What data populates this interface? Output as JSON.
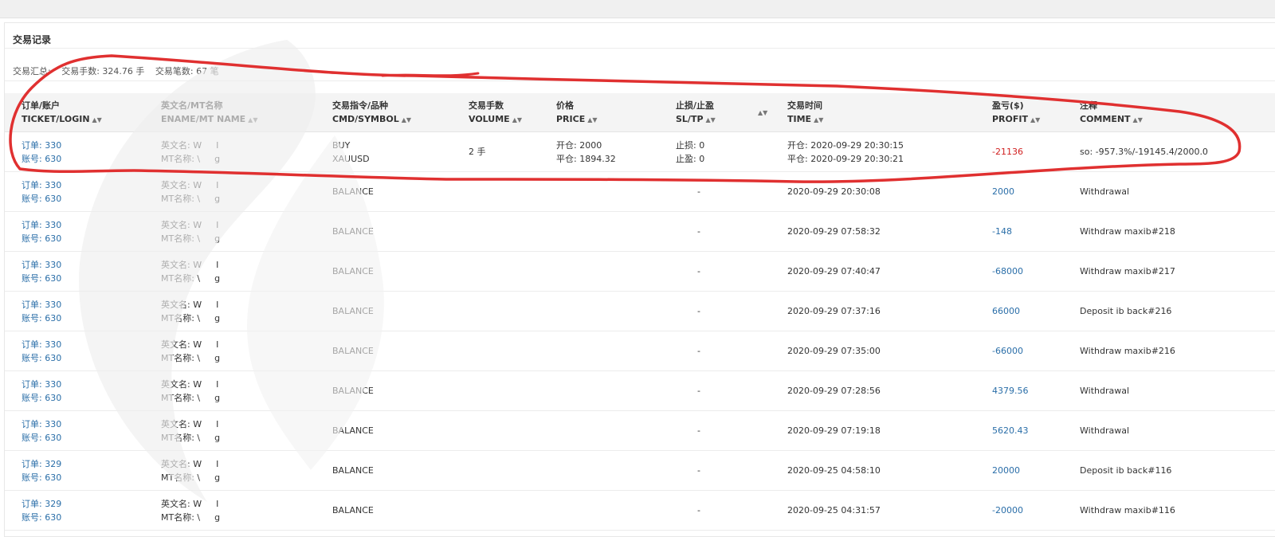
{
  "panel": {
    "title": "交易记录",
    "summary_label": "交易汇总:",
    "volume_summary": "交易手数: 324.76 手",
    "count_summary": "交易笔数: 67 笔"
  },
  "columns": [
    {
      "cn": "订单/账户",
      "en": "TICKET/LOGIN"
    },
    {
      "cn": "英文名/MT名称",
      "en": "ENAME/MT NAME"
    },
    {
      "cn": "交易指令/品种",
      "en": "CMD/SYMBOL"
    },
    {
      "cn": "交易手数",
      "en": "VOLUME"
    },
    {
      "cn": "价格",
      "en": "PRICE"
    },
    {
      "cn": "止损/止盈",
      "en": "SL/TP"
    },
    {
      "cn": "",
      "en": ""
    },
    {
      "cn": "交易时间",
      "en": "TIME"
    },
    {
      "cn": "盈亏($)",
      "en": "PROFIT"
    },
    {
      "cn": "注释",
      "en": "COMMENT"
    }
  ],
  "first_row": {
    "ticket": "订单: 330",
    "login": "账号: 630",
    "ename": "英文名: W",
    "mtname": "MT名称: \\",
    "ename_tail": "I",
    "mtname_tail": "g",
    "cmd": "BUY",
    "symbol": "XAUUSD",
    "volume": "2 手",
    "open_price": "开仓: 2000",
    "close_price": "平仓: 1894.32",
    "sl": "止损: 0",
    "tp": "止盈: 0",
    "open_time": "开仓: 2020-09-29 20:30:15",
    "close_time": "平仓: 2020-09-29 20:30:21",
    "profit": "-21136",
    "comment": "so: -957.3%/-19145.4/2000.0"
  },
  "rows": [
    {
      "ticket": "订单: 330",
      "login": "账号: 630",
      "ename": "英文名: W",
      "mtname": "MT名称: \\",
      "ename_tail": "I",
      "mtname_tail": "g",
      "cmd": "BALANCE",
      "dash": "-",
      "time": "2020-09-29 20:30:08",
      "profit": "2000",
      "comment": "Withdrawal"
    },
    {
      "ticket": "订单: 330",
      "login": "账号: 630",
      "ename": "英文名: W",
      "mtname": "MT名称: \\",
      "ename_tail": "I",
      "mtname_tail": "g",
      "cmd": "BALANCE",
      "dash": "-",
      "time": "2020-09-29 07:58:32",
      "profit": "-148",
      "comment": "Withdraw maxib#218"
    },
    {
      "ticket": "订单: 330",
      "login": "账号: 630",
      "ename": "英文名: W",
      "mtname": "MT名称: \\",
      "ename_tail": "I",
      "mtname_tail": "g",
      "cmd": "BALANCE",
      "dash": "-",
      "time": "2020-09-29 07:40:47",
      "profit": "-68000",
      "comment": "Withdraw maxib#217"
    },
    {
      "ticket": "订单: 330",
      "login": "账号: 630",
      "ename": "英文名: W",
      "mtname": "MT名称: \\",
      "ename_tail": "I",
      "mtname_tail": "g",
      "cmd": "BALANCE",
      "dash": "-",
      "time": "2020-09-29 07:37:16",
      "profit": "66000",
      "comment": "Deposit ib back#216"
    },
    {
      "ticket": "订单: 330",
      "login": "账号: 630",
      "ename": "英文名: W",
      "mtname": "MT名称: \\",
      "ename_tail": "I",
      "mtname_tail": "g",
      "cmd": "BALANCE",
      "dash": "-",
      "time": "2020-09-29 07:35:00",
      "profit": "-66000",
      "comment": "Withdraw maxib#216"
    },
    {
      "ticket": "订单: 330",
      "login": "账号: 630",
      "ename": "英文名: W",
      "mtname": "MT名称: \\",
      "ename_tail": "I",
      "mtname_tail": "g",
      "cmd": "BALANCE",
      "dash": "-",
      "time": "2020-09-29 07:28:56",
      "profit": "4379.56",
      "comment": "Withdrawal"
    },
    {
      "ticket": "订单: 330",
      "login": "账号: 630",
      "ename": "英文名: W",
      "mtname": "MT名称: \\",
      "ename_tail": "I",
      "mtname_tail": "g",
      "cmd": "BALANCE",
      "dash": "-",
      "time": "2020-09-29 07:19:18",
      "profit": "5620.43",
      "comment": "Withdrawal"
    },
    {
      "ticket": "订单: 329",
      "login": "账号: 630",
      "ename": "英文名: W",
      "mtname": "MT名称: \\",
      "ename_tail": "I",
      "mtname_tail": "g",
      "cmd": "BALANCE",
      "dash": "-",
      "time": "2020-09-25 04:58:10",
      "profit": "20000",
      "comment": "Deposit ib back#116"
    },
    {
      "ticket": "订单: 329",
      "login": "账号: 630",
      "ename": "英文名: W",
      "mtname": "MT名称: \\",
      "ename_tail": "I",
      "mtname_tail": "g",
      "cmd": "BALANCE",
      "dash": "-",
      "time": "2020-09-25 04:31:57",
      "profit": "-20000",
      "comment": "Withdraw maxib#116"
    }
  ],
  "colors": {
    "link": "#2a6ea8",
    "loss_highlight": "#d01f1f",
    "annotation_stroke": "#e03030"
  },
  "icons": {
    "sort": "sort-icon",
    "annotation": "red-hand-drawn-circle",
    "watermark": "faded-logo-watermark"
  }
}
